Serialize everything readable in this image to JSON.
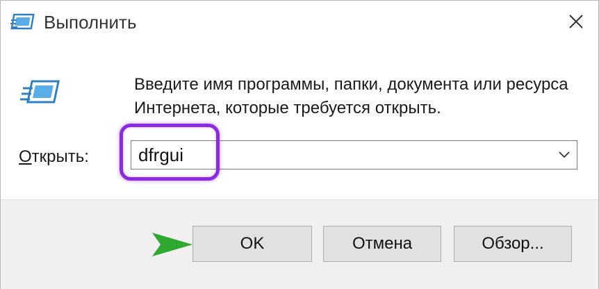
{
  "window": {
    "title": "Выполнить",
    "title_icon": "run-dialog-icon",
    "close_icon": "close-icon"
  },
  "main": {
    "description": "Введите имя программы, папки, документа или ресурса Интернета, которые требуется открыть.",
    "open_label_underlined": "О",
    "open_label_rest": "ткрыть:",
    "open_input_value": "dfrgui",
    "dropdown_icon": "chevron-down-icon"
  },
  "buttons": {
    "ok": "OK",
    "cancel": "Отмена",
    "browse": "Обзор..."
  },
  "annotations": {
    "highlight_color": "#8a2be2",
    "arrow_color": "#2ea82e"
  }
}
